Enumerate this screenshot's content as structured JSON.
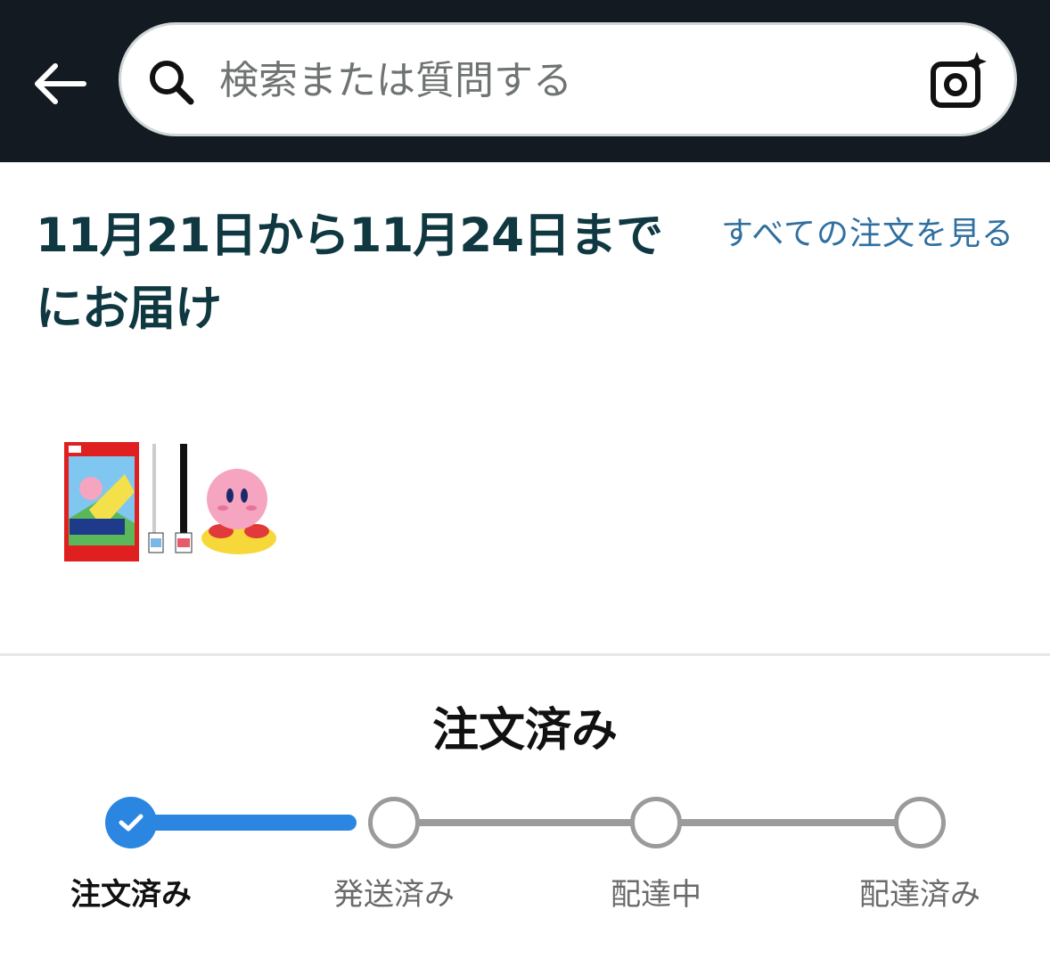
{
  "search": {
    "placeholder": "検索または質問する"
  },
  "delivery": {
    "title": "11月21日から11月24日までにお届け",
    "all_orders_link": "すべての注文を見る"
  },
  "product": {
    "image_alt": "カービィのエアライダー"
  },
  "status": {
    "heading": "注文済み",
    "steps": [
      {
        "label": "注文済み",
        "state": "done"
      },
      {
        "label": "発送済み",
        "state": "pending"
      },
      {
        "label": "配達中",
        "state": "pending"
      },
      {
        "label": "配達済み",
        "state": "pending"
      }
    ],
    "progress_fraction": 0.0
  },
  "colors": {
    "header_bg": "#131a22",
    "title": "#0f3841",
    "link": "#2f6f9f",
    "progress": "#2a86e0",
    "pending": "#9b9b9b"
  }
}
